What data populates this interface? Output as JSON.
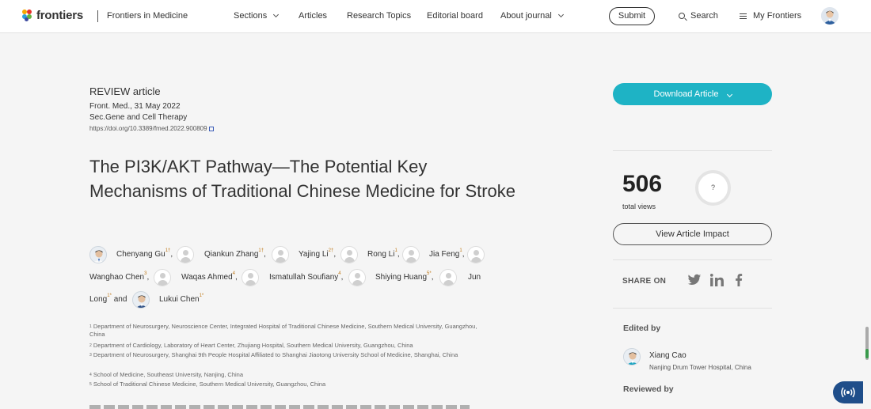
{
  "header": {
    "brand": "frontiers",
    "journal": "Frontiers in Medicine",
    "nav": [
      "Sections",
      "Articles",
      "Research Topics",
      "Editorial board",
      "About journal"
    ],
    "submit_label": "Submit",
    "search_label": "Search",
    "my_frontiers_label": "My Frontiers"
  },
  "article": {
    "type": "REVIEW article",
    "journal_date": "Front. Med., 31 May 2022",
    "section": "Sec.Gene and Cell Therapy",
    "doi": "https://doi.org/10.3389/fmed.2022.900809",
    "title": "The PI3K/AKT Pathway—The Potential Key Mechanisms of Traditional Chinese Medicine for Stroke"
  },
  "authors": [
    {
      "name": "Chenyang Gu",
      "sup": "1†",
      "sep": ","
    },
    {
      "name": "Qiankun Zhang",
      "sup": "1†",
      "sep": ","
    },
    {
      "name": "Yajing Li",
      "sup": "2†",
      "sep": ","
    },
    {
      "name": "Rong Li",
      "sup": "1",
      "sep": ","
    },
    {
      "name": "Jia Feng",
      "sup": "1",
      "sep": ","
    },
    {
      "name": "Wanghao Chen",
      "sup": "3",
      "sep": ","
    },
    {
      "name": "Waqas Ahmed",
      "sup": "4",
      "sep": ","
    },
    {
      "name": "Ismatullah Soufiany",
      "sup": "4",
      "sep": ","
    },
    {
      "name": "Shiying Huang",
      "sup": "5*",
      "sep": ","
    },
    {
      "name_part1": "Jun",
      "name_part2": "Long",
      "sup": "1*",
      "sep": " and"
    },
    {
      "name": "Lukui Chen",
      "sup": "1*",
      "sep": ""
    }
  ],
  "affiliations": [
    {
      "num": "1",
      "text": "Department of Neurosurgery, Neuroscience Center, Integrated Hospital of Traditional Chinese Medicine, Southern Medical University, Guangzhou, China"
    },
    {
      "num": "2",
      "text": "Department of Cardiology, Laboratory of Heart Center, Zhujiang Hospital, Southern Medical University, Guangzhou, China"
    },
    {
      "num": "3",
      "text": "Department of Neurosurgery, Shanghai 9th People Hospital Affiliated to Shanghai Jiaotong University School of Medicine, Shanghai, China"
    },
    {
      "num": "4",
      "text": "School of Medicine, Southeast University, Nanjing, China"
    },
    {
      "num": "5",
      "text": "School of Traditional Chinese Medicine, Southern Medical University, Guangzhou, China"
    }
  ],
  "sidebar": {
    "download_label": "Download Article",
    "views_count": "506",
    "views_label": "total views",
    "altmetric_label": "?",
    "impact_label": "View Article Impact",
    "share_label": "SHARE ON",
    "edited_by_label": "Edited by",
    "editor_name": "Xiang Cao",
    "editor_affiliation": "Nanjing Drum Tower Hospital, China",
    "reviewed_by_label": "Reviewed by"
  },
  "colors": {
    "accent": "#1eb3c5",
    "author_sup": "#c07a1a",
    "a11y": "#1f4e8a"
  }
}
